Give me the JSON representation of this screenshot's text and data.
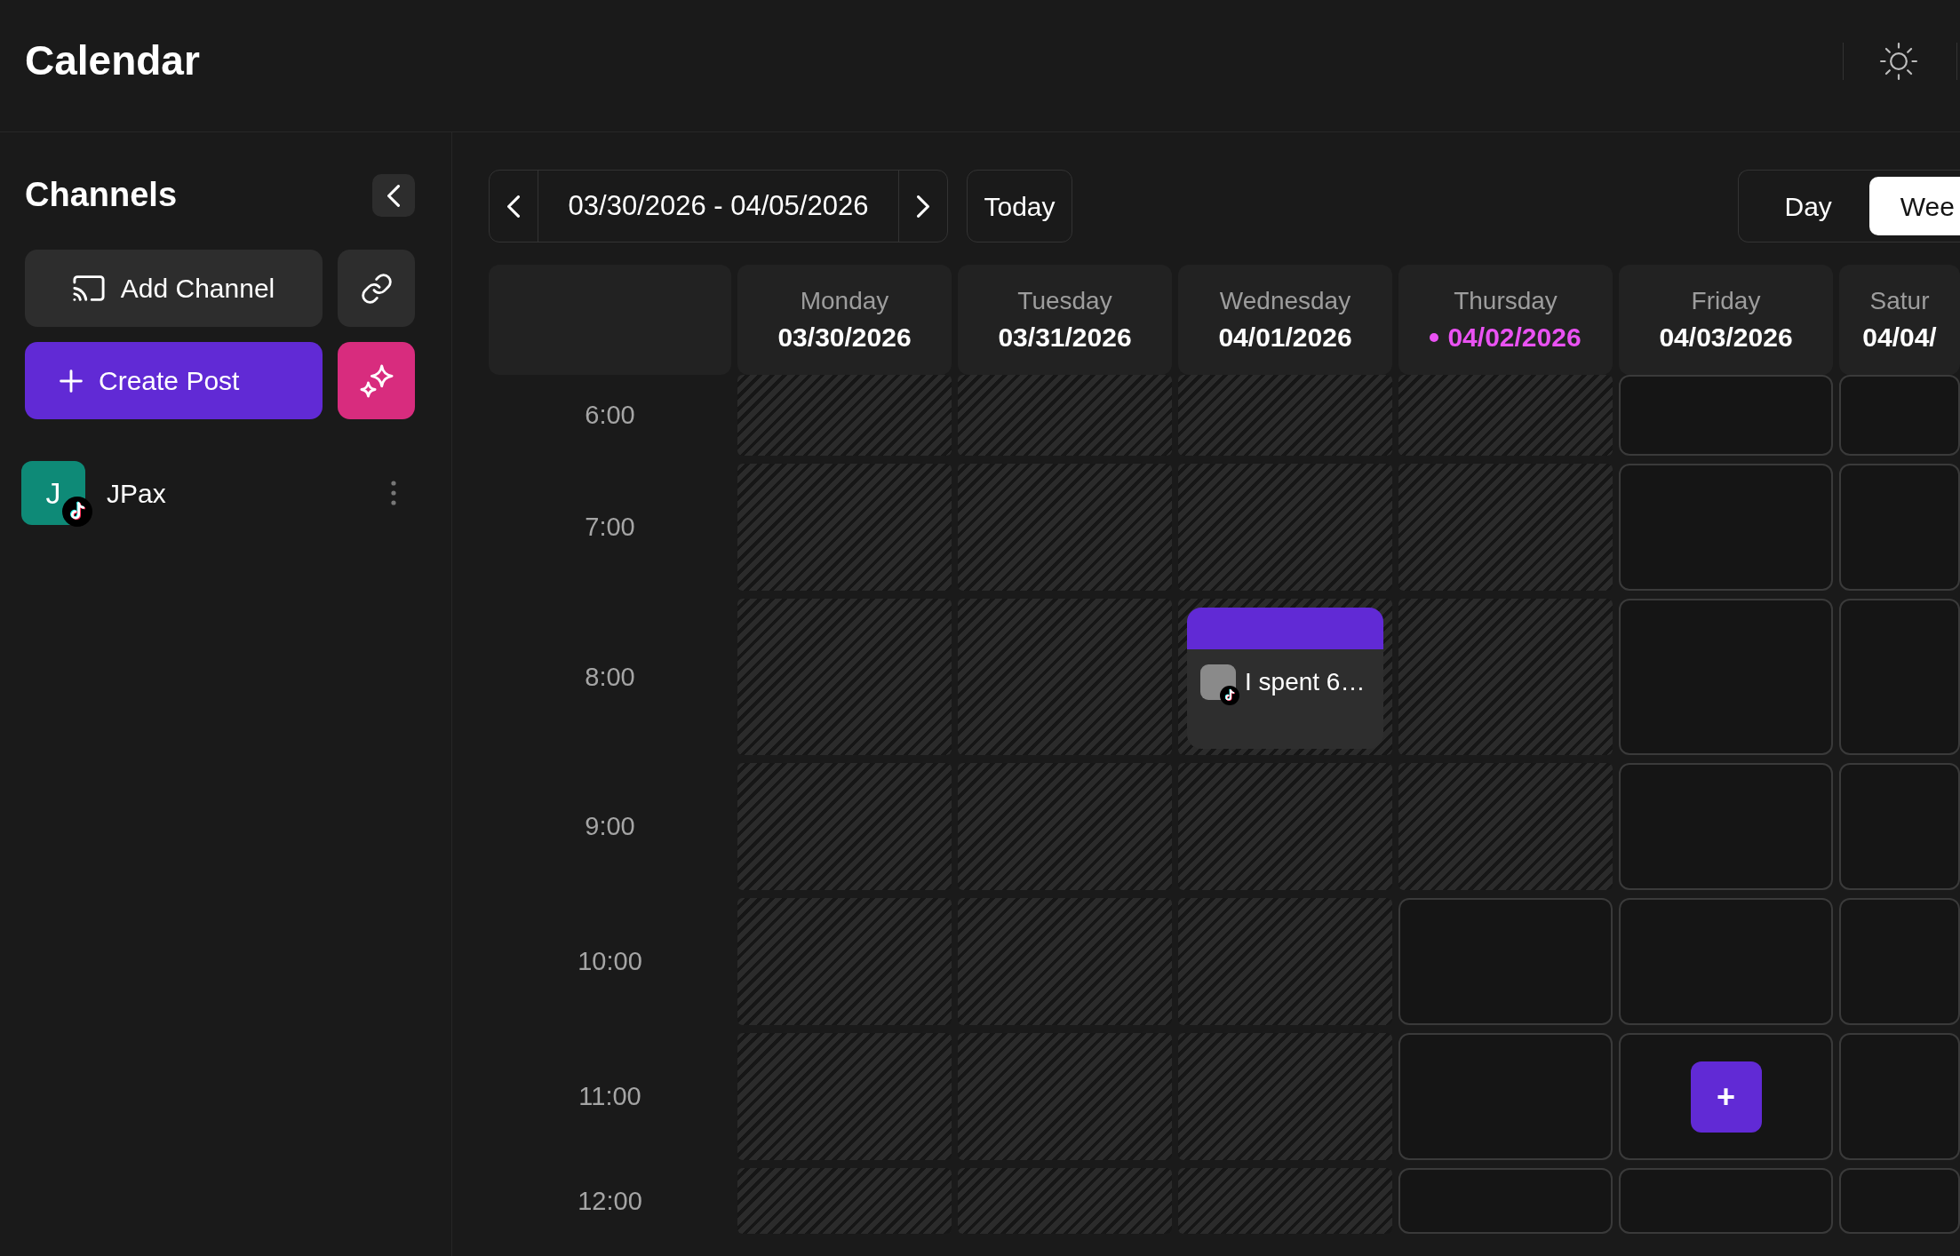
{
  "header": {
    "title": "Calendar"
  },
  "sidebar": {
    "title": "Channels",
    "add_channel": "Add Channel",
    "create_post": "Create Post",
    "channels": [
      {
        "initial": "J",
        "name": "JPax"
      }
    ]
  },
  "toolbar": {
    "date_range": "03/30/2026 - 04/05/2026",
    "today": "Today",
    "views": [
      {
        "label": "Day",
        "selected": false
      },
      {
        "label": "Wee",
        "selected": true
      }
    ]
  },
  "days": [
    {
      "name": "Monday",
      "date": "03/30/2026",
      "today": false
    },
    {
      "name": "Tuesday",
      "date": "03/31/2026",
      "today": false
    },
    {
      "name": "Wednesday",
      "date": "04/01/2026",
      "today": false
    },
    {
      "name": "Thursday",
      "date": "04/02/2026",
      "today": true
    },
    {
      "name": "Friday",
      "date": "04/03/2026",
      "today": false
    },
    {
      "name": "Satur",
      "date": "04/04/",
      "today": false
    }
  ],
  "rows": [
    {
      "time": "6:00",
      "cells": [
        {
          "past": true
        },
        {
          "past": true
        },
        {
          "past": true
        },
        {
          "past": true
        },
        {
          "past": false
        },
        {
          "past": false
        }
      ]
    },
    {
      "time": "7:00",
      "cells": [
        {
          "past": true
        },
        {
          "past": true
        },
        {
          "past": true
        },
        {
          "past": true
        },
        {
          "past": false
        },
        {
          "past": false
        }
      ]
    },
    {
      "time": "8:00",
      "cells": [
        {
          "past": true
        },
        {
          "past": true
        },
        {
          "past": true,
          "posts": [
            {
              "text": "I spent 6…"
            }
          ]
        },
        {
          "past": true
        },
        {
          "past": false
        },
        {
          "past": false
        }
      ]
    },
    {
      "time": "9:00",
      "cells": [
        {
          "past": true
        },
        {
          "past": true
        },
        {
          "past": true
        },
        {
          "past": true
        },
        {
          "past": false
        },
        {
          "past": false
        }
      ]
    },
    {
      "time": "10:00",
      "cells": [
        {
          "past": true
        },
        {
          "past": true
        },
        {
          "past": true
        },
        {
          "past": false
        },
        {
          "past": false
        },
        {
          "past": false
        }
      ]
    },
    {
      "time": "11:00",
      "cells": [
        {
          "past": true
        },
        {
          "past": true
        },
        {
          "past": true
        },
        {
          "past": false
        },
        {
          "past": false,
          "add_button": "+"
        },
        {
          "past": false
        }
      ]
    },
    {
      "time": "12:00",
      "cells": [
        {
          "past": true
        },
        {
          "past": true
        },
        {
          "past": true
        },
        {
          "past": false
        },
        {
          "past": false
        },
        {
          "past": false
        }
      ]
    }
  ]
}
